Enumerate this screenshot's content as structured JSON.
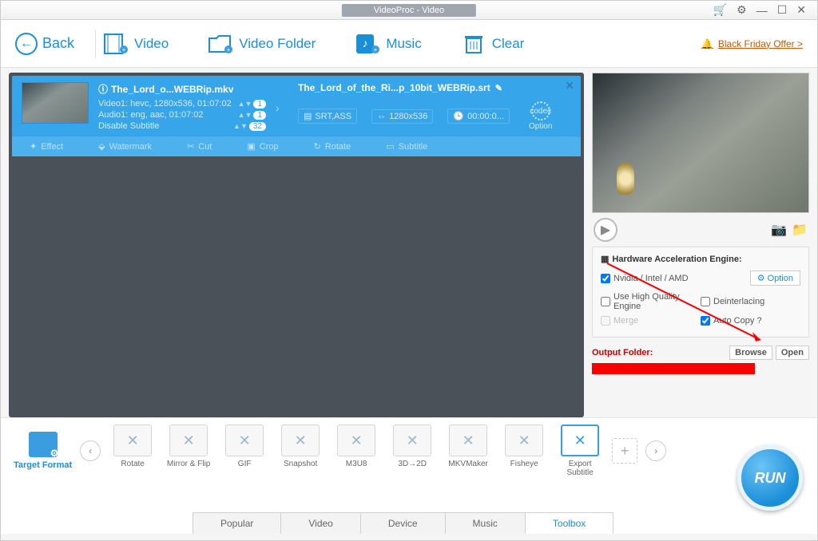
{
  "window": {
    "title": "VideoProc - Video"
  },
  "topbar": {
    "back": "Back",
    "video": "Video",
    "video_folder": "Video Folder",
    "music": "Music",
    "clear": "Clear",
    "promo": "Black Friday Offer >"
  },
  "item": {
    "src_name": "The_Lord_o...WEBRip.mkv",
    "video_line": "Video1: hevc, 1280x536, 01:07:02",
    "audio_line": "Audio1: eng, aac, 01:07:02",
    "subtitle_line": "Disable Subtitle",
    "badge_v": "1",
    "badge_a": "1",
    "badge_s": "32",
    "out_name": "The_Lord_of_the_Ri...p_10bit_WEBRip.srt",
    "out_fmt": "SRT,ASS",
    "out_res": "1280x536",
    "out_dur": "00:00:0...",
    "codec_label": "Option"
  },
  "edit_tabs": {
    "effect": "Effect",
    "watermark": "Watermark",
    "cut": "Cut",
    "crop": "Crop",
    "rotate": "Rotate",
    "subtitle": "Subtitle"
  },
  "hw": {
    "title": "Hardware Acceleration Engine:",
    "gpu": "Nvidia / Intel / AMD",
    "option": "Option",
    "hq": "Use High Quality Engine",
    "deint": "Deinterlacing",
    "merge": "Merge",
    "autocopy": "Auto Copy ?"
  },
  "output": {
    "label": "Output Folder:",
    "browse": "Browse",
    "open": "Open"
  },
  "target_format_label": "Target Format",
  "formats": {
    "rotate": "Rotate",
    "mirror": "Mirror & Flip",
    "gif": "GIF",
    "snapshot": "Snapshot",
    "m3u8": "M3U8",
    "3d2d": "3D→2D",
    "mkvmaker": "MKVMaker",
    "fisheye": "Fisheye",
    "export_sub": "Export Subtitle"
  },
  "bottom_tabs": {
    "popular": "Popular",
    "video": "Video",
    "device": "Device",
    "music": "Music",
    "toolbox": "Toolbox"
  },
  "run": "RUN"
}
